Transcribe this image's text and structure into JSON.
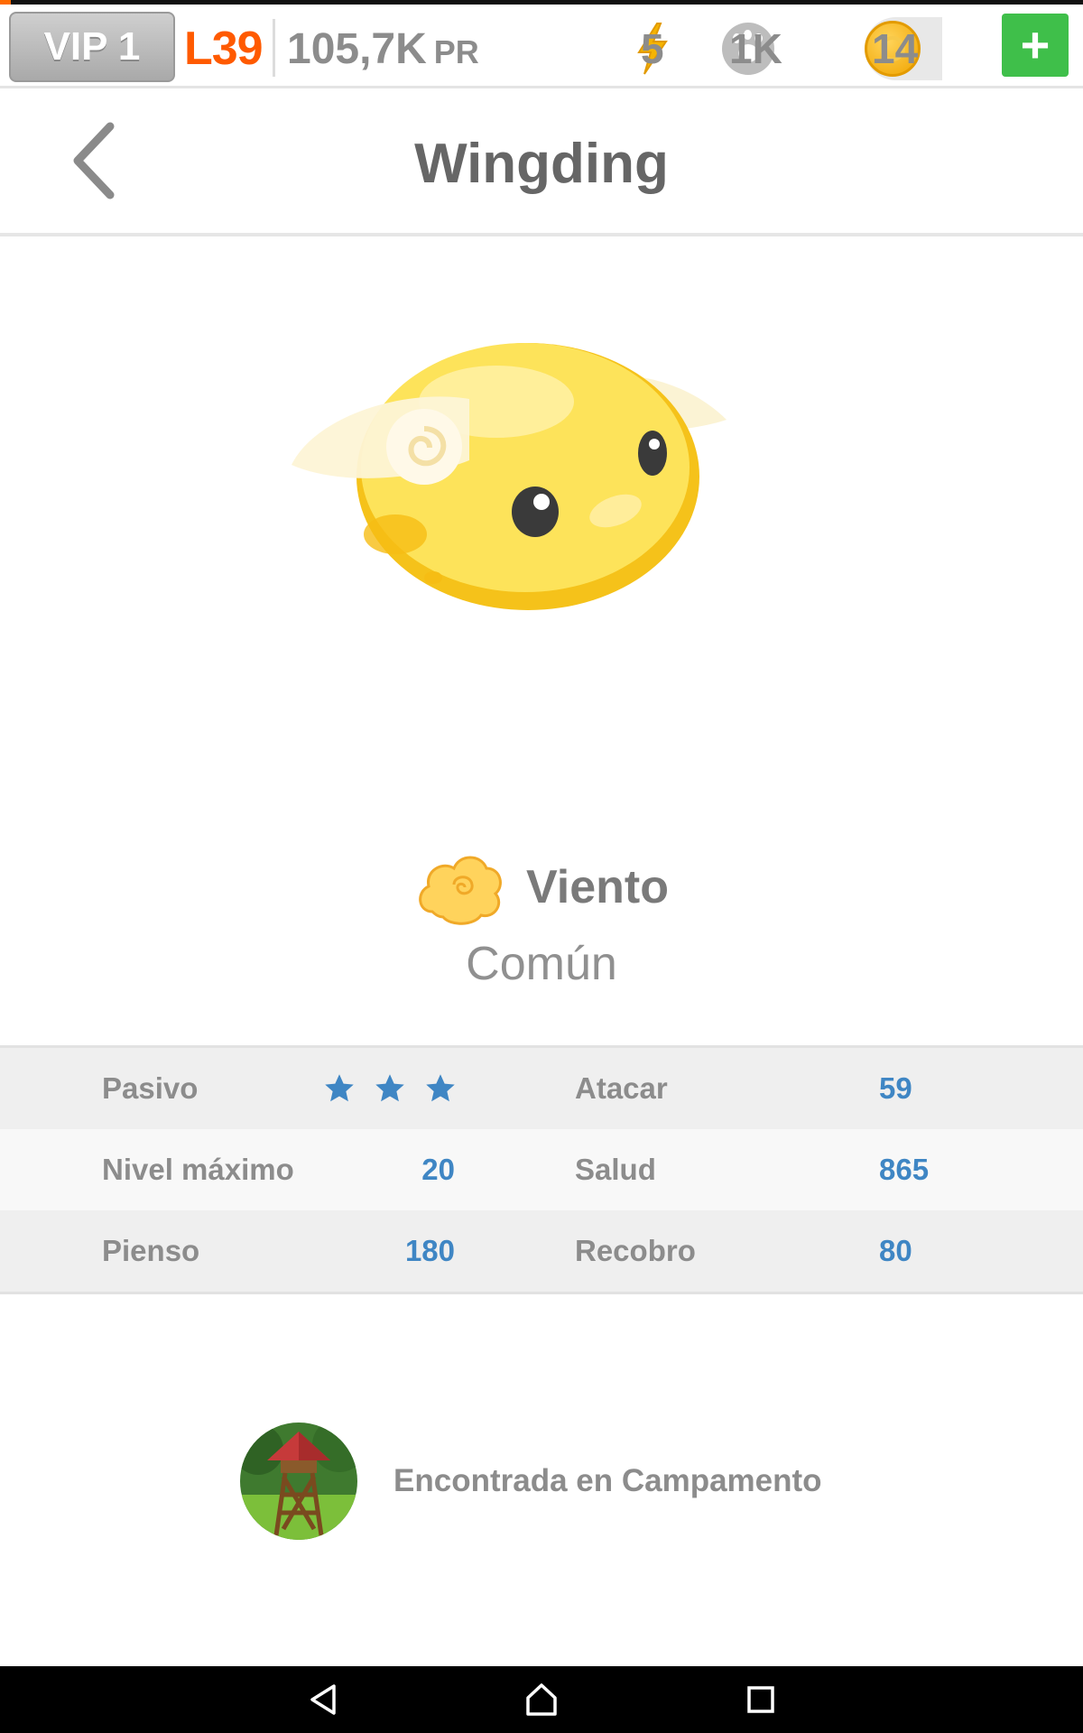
{
  "topbar": {
    "vip": "VIP 1",
    "level": "L39",
    "power_value": "105,7K",
    "power_unit": "PR",
    "energy": "5",
    "paws": "1K",
    "coins": "14",
    "plus": "+"
  },
  "header": {
    "title": "Wingding"
  },
  "pet": {
    "element": "Viento",
    "rarity": "Común",
    "element_icon": "wind-cloud-icon",
    "pet_image": "wingding-creature"
  },
  "stats": {
    "rows": [
      {
        "left_label": "Pasivo",
        "left_stars": 3,
        "right_label": "Atacar",
        "right_value": "59"
      },
      {
        "left_label": "Nivel máximo",
        "left_value": "20",
        "right_label": "Salud",
        "right_value": "865"
      },
      {
        "left_label": "Pienso",
        "left_value": "180",
        "right_label": "Recobro",
        "right_value": "80"
      }
    ]
  },
  "location": {
    "text": "Encontrada en Campamento",
    "icon": "campamento-tower-icon"
  },
  "colors": {
    "accent_orange": "#ff5a00",
    "stat_value_blue": "#3f86c4",
    "plus_green": "#3fbf4a",
    "label_gray": "#8c8c8c"
  }
}
